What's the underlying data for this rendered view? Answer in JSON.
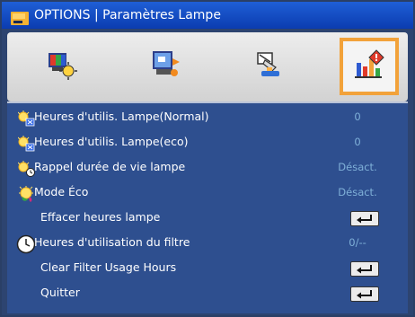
{
  "window": {
    "title": "OPTIONS | Paramètres Lampe",
    "colors": {
      "title_bar": "#0b3cb0",
      "body": "#2e4f8f",
      "selected_tab": "#f2a23a",
      "value_text": "#7fb0d8"
    }
  },
  "tabs": [
    {
      "icon": "picture-settings-icon"
    },
    {
      "icon": "display-settings-icon"
    },
    {
      "icon": "setup-settings-icon"
    },
    {
      "icon": "options-settings-icon",
      "selected": true
    }
  ],
  "rows": [
    {
      "label": "Heures d'utilis. Lampe(Normal)",
      "value": "0",
      "icon": "lamp-hours-icon"
    },
    {
      "label": "Heures d'utilis. Lampe(eco)",
      "value": "0",
      "icon": "lamp-eco-hours-icon"
    },
    {
      "label": "Rappel durée de vie lampe",
      "value": "Désact.",
      "icon": "lamp-reminder-icon"
    },
    {
      "label": "Mode  Éco",
      "value": "Désact.",
      "icon": "eco-mode-icon"
    },
    {
      "label": "Effacer heures lampe",
      "value": "",
      "icon": "enter-key-icon"
    },
    {
      "label": "Heures d'utilisation du filtre",
      "value": "0/--",
      "icon": "clock-icon"
    },
    {
      "label": "Clear Filter Usage Hours",
      "value": "",
      "icon": "enter-key-icon"
    },
    {
      "label": "Quitter",
      "value": "",
      "icon": "enter-key-icon"
    }
  ]
}
